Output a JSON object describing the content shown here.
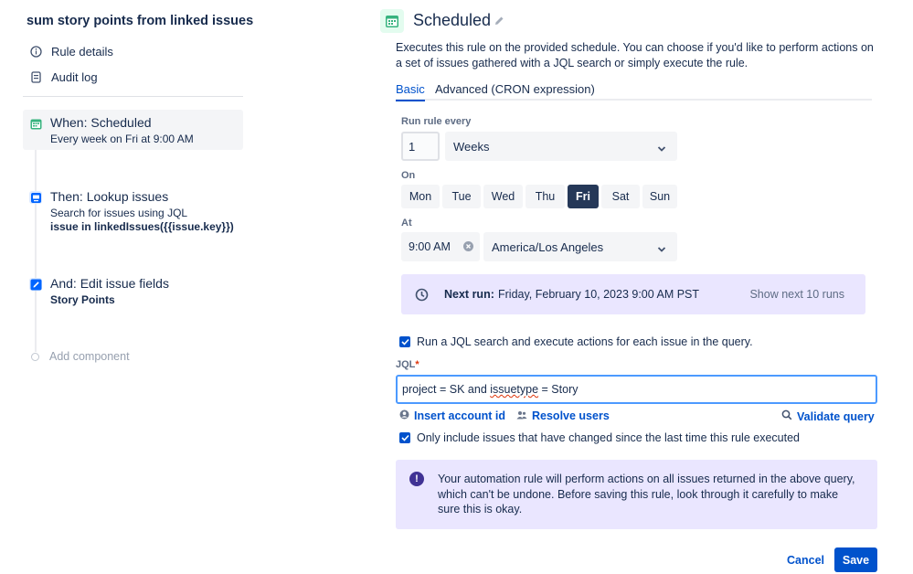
{
  "sidebar": {
    "rule_name": "sum story points from linked issues",
    "nav": [
      {
        "label": "Rule details",
        "icon": "info-icon"
      },
      {
        "label": "Audit log",
        "icon": "document-icon"
      }
    ],
    "steps": [
      {
        "title": "When: Scheduled",
        "subtitle": "Every week on Fri at 9:00 AM",
        "icon": "calendar-icon",
        "icon_color": "#36b37e"
      },
      {
        "title": "Then: Lookup issues",
        "subtitle": "Search for issues using JQL",
        "detail": "issue in linkedIssues({{issue.key}})",
        "icon": "lookup-icon",
        "icon_color": "#0065ff"
      },
      {
        "title": "And: Edit issue fields",
        "detail": "Story Points",
        "icon": "pencil-icon",
        "icon_color": "#0065ff"
      }
    ],
    "add_component": "Add component"
  },
  "header": {
    "title": "Scheduled",
    "description": "Executes this rule on the provided schedule. You can choose if you'd like to perform actions on a set of issues gathered with a JQL search or simply execute the rule."
  },
  "tabs": [
    {
      "label": "Basic",
      "active": true
    },
    {
      "label": "Advanced (CRON expression)",
      "active": false
    }
  ],
  "schedule": {
    "run_every_label": "Run rule every",
    "run_every_value": "1",
    "period": "Weeks",
    "on_label": "On",
    "days": [
      "Mon",
      "Tue",
      "Wed",
      "Thu",
      "Fri",
      "Sat",
      "Sun"
    ],
    "selected_day": "Fri",
    "at_label": "At",
    "time": "9:00 AM",
    "timezone": "America/Los Angeles"
  },
  "next_run": {
    "label": "Next run:",
    "value": "Friday, February 10, 2023 9:00 AM PST",
    "show_more": "Show next 10 runs"
  },
  "jql": {
    "run_search_label": "Run a JQL search and execute actions for each issue in the query.",
    "field_label": "JQL",
    "required_mark": "*",
    "query_prefix": "project = SK and ",
    "query_misspelled": "issuetype",
    "query_suffix": " = Story",
    "insert_account": "Insert account id",
    "resolve_users": "Resolve users",
    "validate": "Validate query",
    "only_changed_label": "Only include issues that have changed since the last time this rule executed"
  },
  "warning": {
    "icon": "!",
    "text": "Your automation rule will perform actions on all issues returned in the above query, which can't be undone. Before saving this rule, look through it carefully to make sure this is okay."
  },
  "actions": {
    "cancel": "Cancel",
    "save": "Save"
  },
  "colors": {
    "primary": "#0052cc",
    "selected_day": "#253858",
    "info_bg": "#eae6ff",
    "schedule_icon_bg": "#e3fcef"
  }
}
